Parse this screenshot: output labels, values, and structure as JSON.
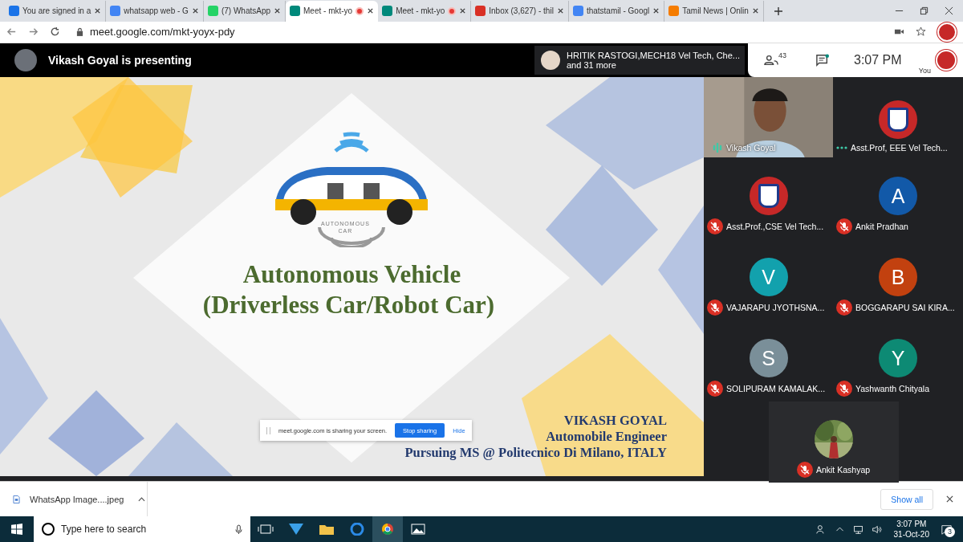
{
  "browser": {
    "tabs": [
      {
        "title": "You are signed in a",
        "selected": false,
        "recording": false
      },
      {
        "title": "whatsapp web - G",
        "selected": false,
        "recording": false
      },
      {
        "title": "(7) WhatsApp",
        "selected": false,
        "recording": false
      },
      {
        "title": "Meet - mkt-yo",
        "selected": true,
        "recording": true
      },
      {
        "title": "Meet - mkt-yo",
        "selected": false,
        "recording": true
      },
      {
        "title": "Inbox (3,627) - thil",
        "selected": false,
        "recording": false
      },
      {
        "title": "thatstamil - Googl",
        "selected": false,
        "recording": false
      },
      {
        "title": "Tamil News | Onlin",
        "selected": false,
        "recording": false
      }
    ],
    "url": "meet.google.com/mkt-yoyx-pdy"
  },
  "meet": {
    "presenting": "Vikash Goyal is presenting",
    "notice": {
      "line_1": "HRITIK RASTOGI,MECH18 Vel Tech, Che...",
      "line_2": "and 31 more"
    },
    "people_count": "43",
    "time": "3:07 PM",
    "self_label": "You"
  },
  "slide": {
    "logo_text": [
      "AUTONOMOUS",
      "CAR"
    ],
    "title": "Autonomous Vehicle",
    "subtitle": "(Driverless Car/Robot Car)",
    "author": [
      "VIKASH GOYAL",
      "Automobile Engineer",
      "Pursuing MS @ Politecnico Di Milano, ITALY"
    ]
  },
  "sharing_bar": {
    "message": "meet.google.com is sharing your screen.",
    "stop": "Stop sharing",
    "hide": "Hide"
  },
  "participants": [
    {
      "name": "Vikash Goyal",
      "kind": "video",
      "muted": false,
      "speaking": true
    },
    {
      "name": "Asst.Prof, EEE Vel Tech...",
      "kind": "logo",
      "muted": false,
      "speaking": false
    },
    {
      "name": "Asst.Prof.,CSE Vel Tech...",
      "kind": "logo",
      "muted": true,
      "speaking": false
    },
    {
      "name": "Ankit Pradhan",
      "kind": "letter",
      "initial": "A",
      "color": "#1259a8",
      "muted": true,
      "speaking": false
    },
    {
      "name": "VAJARAPU JYOTHSNA...",
      "kind": "letter",
      "initial": "V",
      "color": "#12a1ad",
      "muted": true,
      "speaking": false
    },
    {
      "name": "BOGGARAPU SAI KIRA...",
      "kind": "letter",
      "initial": "B",
      "color": "#c2410f",
      "muted": true,
      "speaking": false
    },
    {
      "name": "SOLIPURAM KAMALAK...",
      "kind": "letter",
      "initial": "S",
      "color": "#7a8f99",
      "muted": true,
      "speaking": false
    },
    {
      "name": "Yashwanth Chityala",
      "kind": "letter",
      "initial": "Y",
      "color": "#0d8a74",
      "muted": true,
      "speaking": false
    },
    {
      "name": "Ankit Kashyap",
      "muted": true,
      "speaking": false
    }
  ],
  "download": {
    "file": "WhatsApp Image....jpeg",
    "show_all": "Show all"
  },
  "taskbar": {
    "search": "Type here to search",
    "time": "3:07 PM",
    "date": "31-Oct-20",
    "notifications": "3"
  }
}
